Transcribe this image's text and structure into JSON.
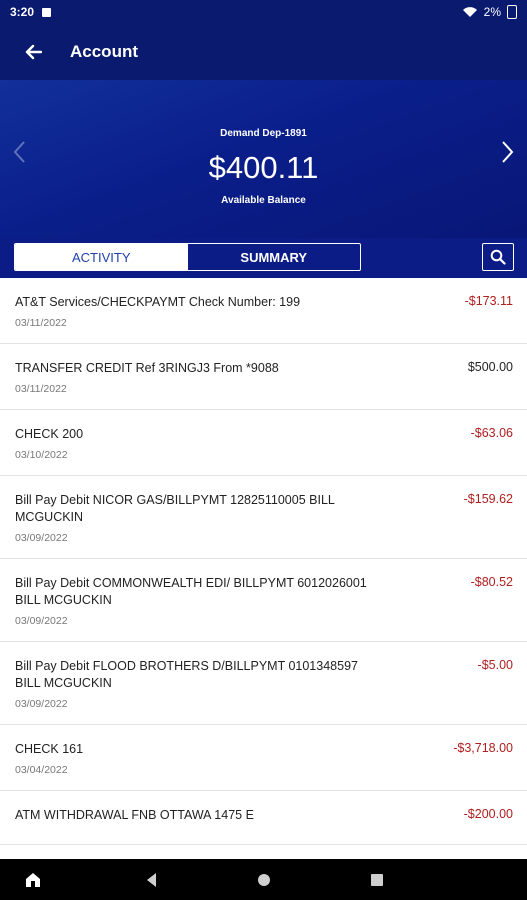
{
  "status_bar": {
    "time": "3:20",
    "battery": "2%"
  },
  "app_bar": {
    "title": "Account",
    "back_icon": "arrow-back-icon"
  },
  "account": {
    "name": "Demand Dep-1891",
    "balance": "$400.11",
    "balance_label": "Available Balance"
  },
  "tabs": [
    {
      "label": "ACTIVITY",
      "active": true
    },
    {
      "label": "SUMMARY",
      "active": false
    }
  ],
  "transactions": [
    {
      "description": "AT&T Services/CHECKPAYMT Check Number: 199",
      "date": "03/11/2022",
      "amount": "-$173.11",
      "negative": true
    },
    {
      "description": "TRANSFER CREDIT Ref 3RINGJ3 From *9088",
      "date": "03/11/2022",
      "amount": "$500.00",
      "negative": false
    },
    {
      "description": "CHECK 200",
      "date": "03/10/2022",
      "amount": "-$63.06",
      "negative": true
    },
    {
      "description": "Bill Pay Debit NICOR GAS/BILLPYMT 12825110005 BILL MCGUCKIN",
      "date": "03/09/2022",
      "amount": "-$159.62",
      "negative": true
    },
    {
      "description": "Bill Pay Debit COMMONWEALTH EDI/ BILLPYMT 6012026001 BILL MCGUCKIN",
      "date": "03/09/2022",
      "amount": "-$80.52",
      "negative": true
    },
    {
      "description": "Bill Pay Debit FLOOD BROTHERS D/BILLPYMT 0101348597 BILL MCGUCKIN",
      "date": "03/09/2022",
      "amount": "-$5.00",
      "negative": true
    },
    {
      "description": "CHECK 161",
      "date": "03/04/2022",
      "amount": "-$3,718.00",
      "negative": true
    },
    {
      "description": "ATM WITHDRAWAL FNB OTTAWA 1475 E",
      "date": "",
      "amount": "-$200.00",
      "negative": true
    }
  ],
  "colors": {
    "header": "#0a1a6e",
    "negative": "#b01e1e",
    "tab_active_text": "#1e3fae"
  }
}
